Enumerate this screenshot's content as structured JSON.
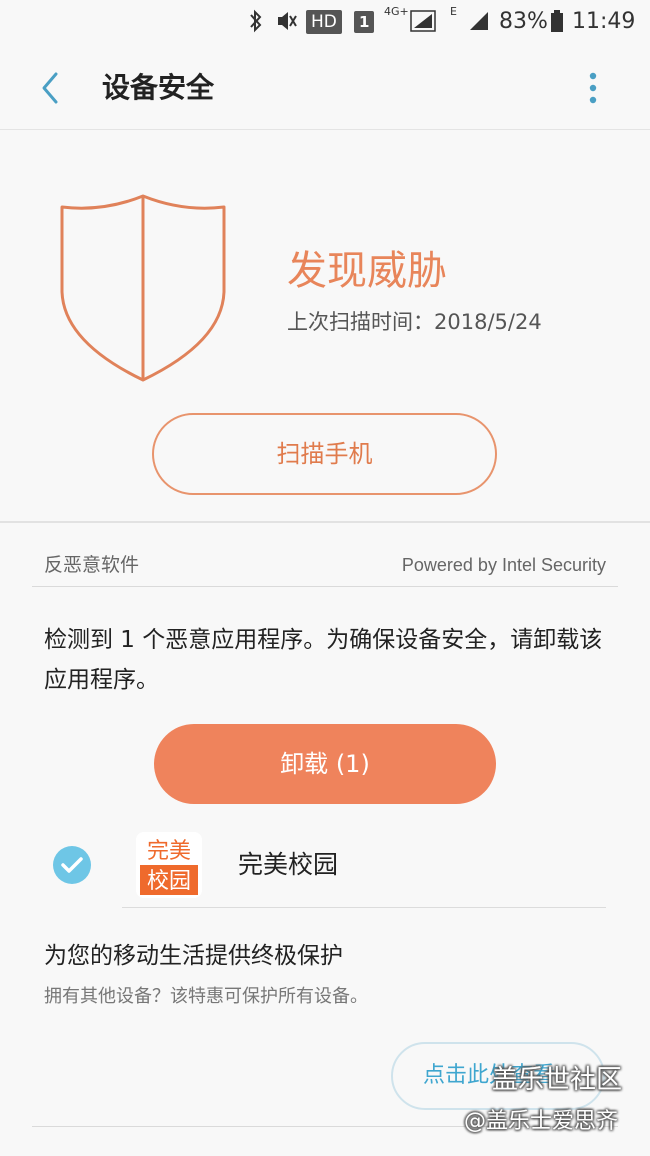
{
  "status_bar": {
    "hd": "HD",
    "sim": "1",
    "network_4g": "4G+",
    "network_e": "E",
    "battery": "83%",
    "time": "11:49"
  },
  "header": {
    "title": "设备安全"
  },
  "threat": {
    "status": "发现威胁",
    "last_scan": "上次扫描时间：2018/5/24",
    "scan_button": "扫描手机"
  },
  "antimalware": {
    "section_label": "反恶意软件",
    "powered_by": "Powered by Intel Security",
    "description": "检测到 1 个恶意应用程序。为确保设备安全，请卸载该应用程序。",
    "uninstall_button": "卸载 (1)"
  },
  "apps": [
    {
      "name": "完美校园",
      "icon_text_top": "完美",
      "icon_text_bottom": "校园",
      "checked": true
    }
  ],
  "promo": {
    "title": "为您的移动生活提供终极保护",
    "subtitle": "拥有其他设备？该特惠可保护所有设备。",
    "button": "点击此处查看"
  },
  "watermark": {
    "line1": "盖乐世社区",
    "line2": "@盖乐士爱思齐"
  },
  "colors": {
    "accent_orange": "#ef835c",
    "shield_stroke": "#e0825a",
    "check_blue": "#6ec6e6",
    "link_blue": "#3fa6cf"
  }
}
